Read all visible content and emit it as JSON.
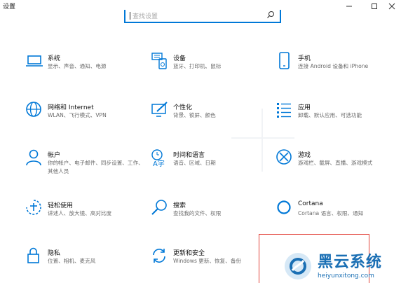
{
  "window": {
    "title": "设置"
  },
  "search": {
    "placeholder": "查找设置"
  },
  "tiles": [
    {
      "title": "系统",
      "desc": "显示、声音、通知、电源"
    },
    {
      "title": "设备",
      "desc": "蓝牙、打印机、鼠标"
    },
    {
      "title": "手机",
      "desc": "连接 Android 设备和 iPhone"
    },
    {
      "title": "网络和 Internet",
      "desc": "WLAN、飞行模式、VPN"
    },
    {
      "title": "个性化",
      "desc": "背景、锁屏、颜色"
    },
    {
      "title": "应用",
      "desc": "卸载、默认应用、可选功能"
    },
    {
      "title": "帐户",
      "desc": "你的帐户、电子邮件、同步设置、工作、其他人员"
    },
    {
      "title": "时间和语言",
      "desc": "语音、区域、日期"
    },
    {
      "title": "游戏",
      "desc": "游戏栏、截屏、直播、游戏模式"
    },
    {
      "title": "轻松使用",
      "desc": "讲述人、放大镜、高对比度"
    },
    {
      "title": "搜索",
      "desc": "查找我的文件、权限"
    },
    {
      "title": "Cortana",
      "desc": "Cortana 语言、权限、通知"
    },
    {
      "title": "隐私",
      "desc": "位置、相机、麦克风"
    },
    {
      "title": "更新和安全",
      "desc": "Windows 更新、恢复、备份"
    }
  ],
  "watermark": {
    "brand": "黑云系统",
    "url": "heiyunxitong.com"
  },
  "colors": {
    "accent": "#0078d7",
    "highlight": "#e2433a"
  }
}
